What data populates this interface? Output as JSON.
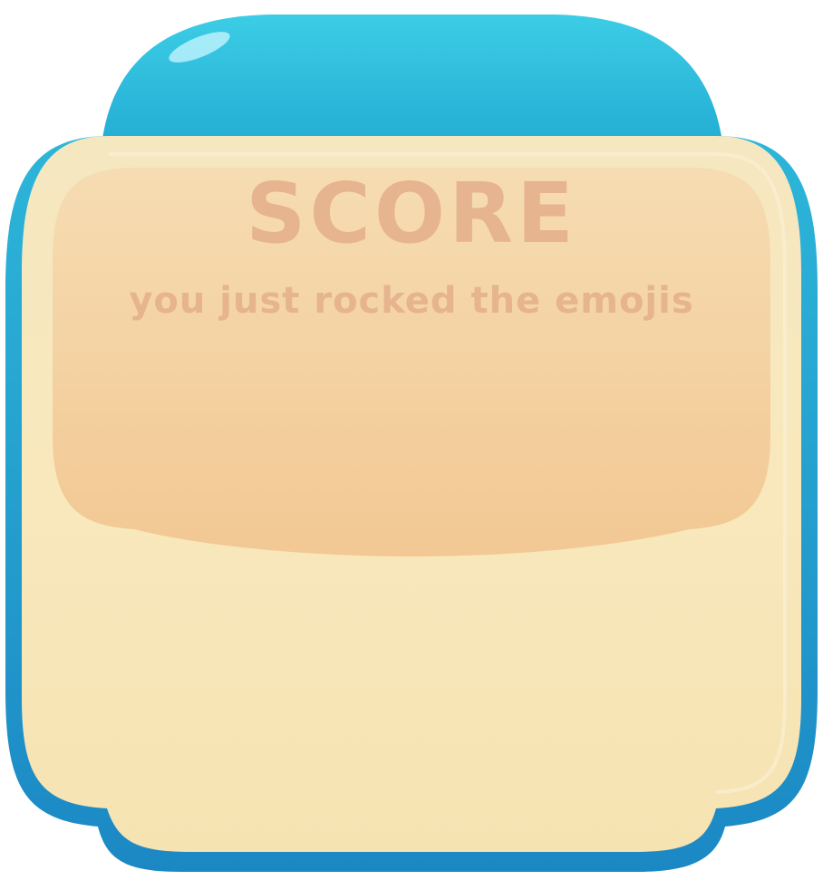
{
  "panel": {
    "title": "SCORE",
    "subtitle": "you just rocked the emojis"
  },
  "colors": {
    "frame_blue": "#2fb8d8",
    "frame_blue_dark": "#1a8fc0",
    "body_cream": "#f7e6bb",
    "inner_peach": "#f3cd9c",
    "text_peach": "#e6b48e"
  }
}
